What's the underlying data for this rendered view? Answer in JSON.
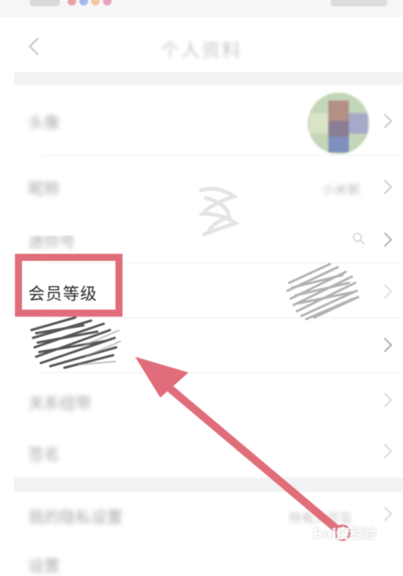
{
  "overlay": {
    "highlight_text": "会员等级",
    "watermark": "Bai度经验"
  },
  "colors": {
    "annotation": "#e06d7a",
    "section_gap": "#f2f2f4",
    "chevron": "#cfcfcf"
  },
  "icons": {
    "back": "chevron-left-icon",
    "row_arrow": "chevron-right-icon"
  }
}
